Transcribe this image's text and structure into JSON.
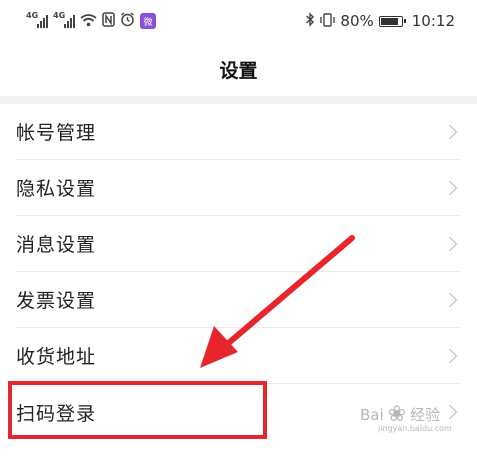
{
  "status_bar": {
    "network_1": "4G",
    "network_2": "4G",
    "battery_percent": "80%",
    "time": "10:12",
    "app_badge": "微"
  },
  "header": {
    "title": "设置"
  },
  "settings": {
    "items": [
      {
        "label": "帐号管理"
      },
      {
        "label": "隐私设置"
      },
      {
        "label": "消息设置"
      },
      {
        "label": "发票设置"
      },
      {
        "label": "收货地址"
      },
      {
        "label": "扫码登录"
      }
    ]
  },
  "annotation": {
    "color": "#e8242d"
  },
  "watermark": {
    "brand": "Bai",
    "brand_cn": "经验",
    "sub": "jingyan.baidu.com"
  }
}
